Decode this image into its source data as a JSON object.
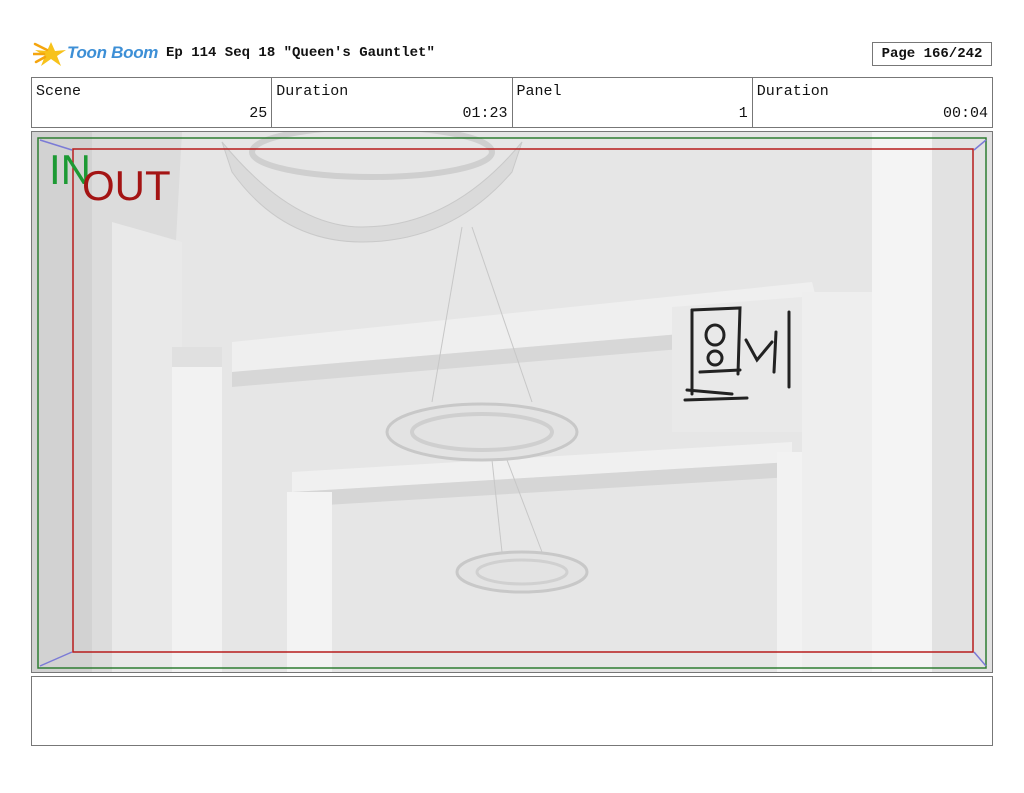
{
  "header": {
    "logo_text": "Toon Boom",
    "title": "Ep 114 Seq 18 \"Queen's Gauntlet\"",
    "page": "Page 166/242"
  },
  "info": {
    "scene_label": "Scene",
    "scene_value": "25",
    "duration_label": "Duration",
    "duration_value": "01:23",
    "panel_label": "Panel",
    "panel_value": "1",
    "panel_duration_label": "Duration",
    "panel_duration_value": "00:04"
  },
  "frame": {
    "in_label": "IN",
    "out_label": "OUT",
    "in_color": "#1d9a34",
    "out_color": "#a41414"
  },
  "notes": {
    "text": ""
  }
}
